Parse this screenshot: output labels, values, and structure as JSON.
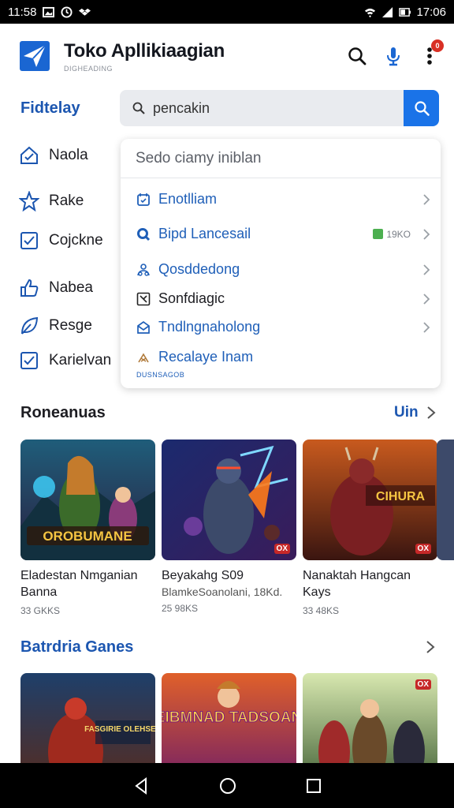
{
  "status_bar": {
    "time_left": "11:58",
    "time_right": "17:06"
  },
  "app": {
    "title": "Toko Apllikiaagian",
    "subtitle": "DIGHEADING",
    "brand_color": "#1a73e8",
    "notification_count": "0"
  },
  "filter": {
    "label": "Fidtelay"
  },
  "search": {
    "value": "pencakin"
  },
  "nav": {
    "items": [
      {
        "label": "Naola",
        "icon": "tag-icon"
      },
      {
        "label": "Rake",
        "icon": "star-icon"
      },
      {
        "label": "Cojckne",
        "icon": "checkbox-icon"
      },
      {
        "label": "Nabea",
        "icon": "thumbs-up-icon"
      },
      {
        "label": "Resge",
        "icon": "leaf-icon"
      },
      {
        "label": "Karielvan",
        "icon": "checkbox-icon"
      }
    ]
  },
  "dropdown": {
    "header": "Sedo ciamy iniblan",
    "items": [
      {
        "label": "Enotlliam",
        "icon": "calendar-icon"
      },
      {
        "label": "Bipd Lancesail",
        "icon": "search-icon",
        "badge": "19KO"
      },
      {
        "label": "Qosddedong",
        "icon": "people-icon"
      },
      {
        "label": "Sonfdiagic",
        "icon": "checkbox-icon"
      },
      {
        "label": "Tndlngnaholong",
        "icon": "mail-icon"
      },
      {
        "label": "Recalaye Inam",
        "icon": "sparkle-icon"
      }
    ],
    "footer": "DUSNSAGOB"
  },
  "section1": {
    "title": "Roneanuas",
    "more": "Uin",
    "cards": [
      {
        "title": "Eladestan Nmganian Banna",
        "meta": "33 GKKS",
        "art": "OROBUMANE"
      },
      {
        "title": "Beyakahg S09",
        "subtitle": "BlamkeSoanolani, 18Kd.",
        "meta": "25 98KS",
        "badge": "OX"
      },
      {
        "title": "Nanaktah Hangcan Kays",
        "meta": "33 48KS",
        "art": "CIHURA",
        "badge": "OX"
      }
    ]
  },
  "section2": {
    "title": "Batrdria Ganes",
    "cards": [
      {
        "art": "FASGIRIE OLEHSEN"
      },
      {
        "art": "SEIBMNAD TADSOANS"
      },
      {
        "badge": "OX"
      }
    ]
  }
}
